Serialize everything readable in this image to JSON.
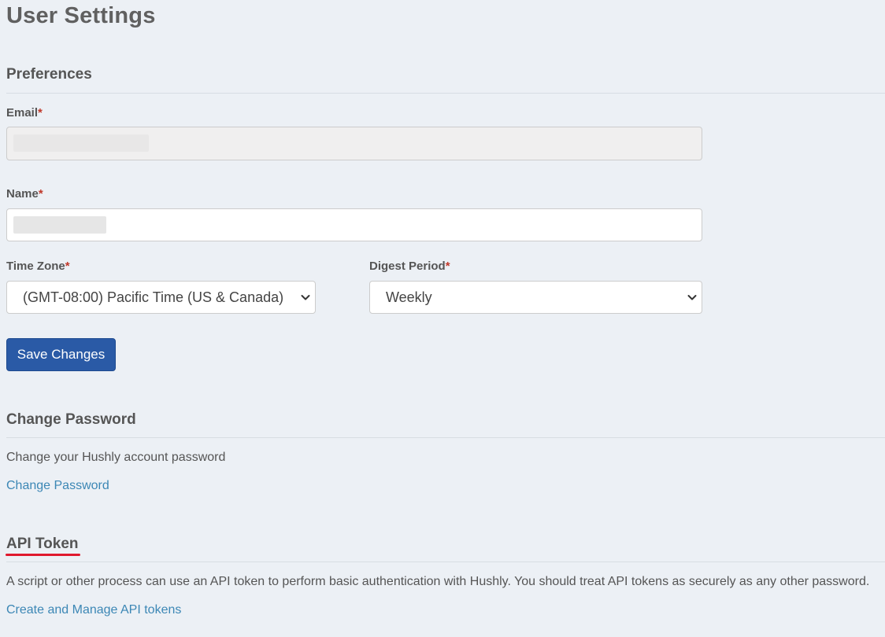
{
  "page": {
    "title": "User Settings"
  },
  "preferences": {
    "heading": "Preferences",
    "email": {
      "label": "Email",
      "required_mark": "*",
      "value": ""
    },
    "name": {
      "label": "Name",
      "required_mark": "*",
      "value": ""
    },
    "time_zone": {
      "label": "Time Zone",
      "required_mark": "*",
      "selected": "(GMT-08:00) Pacific Time (US & Canada)"
    },
    "digest_period": {
      "label": "Digest Period",
      "required_mark": "*",
      "selected": "Weekly"
    },
    "save_label": "Save Changes"
  },
  "change_password": {
    "heading": "Change Password",
    "description": "Change your Hushly account password",
    "link_label": "Change Password"
  },
  "api_token": {
    "heading": "API Token",
    "description": "A script or other process can use an API token to perform basic authentication with Hushly. You should treat API tokens as securely as any other password.",
    "link_label": "Create and Manage API tokens"
  },
  "colors": {
    "background": "#ecf0f5",
    "primary_button": "#2a5aa6",
    "link": "#3c87b5",
    "required_mark": "#c0392b",
    "annotation_underline": "#e0192e"
  },
  "icons": {
    "select_arrow": "chevron-down-icon"
  }
}
